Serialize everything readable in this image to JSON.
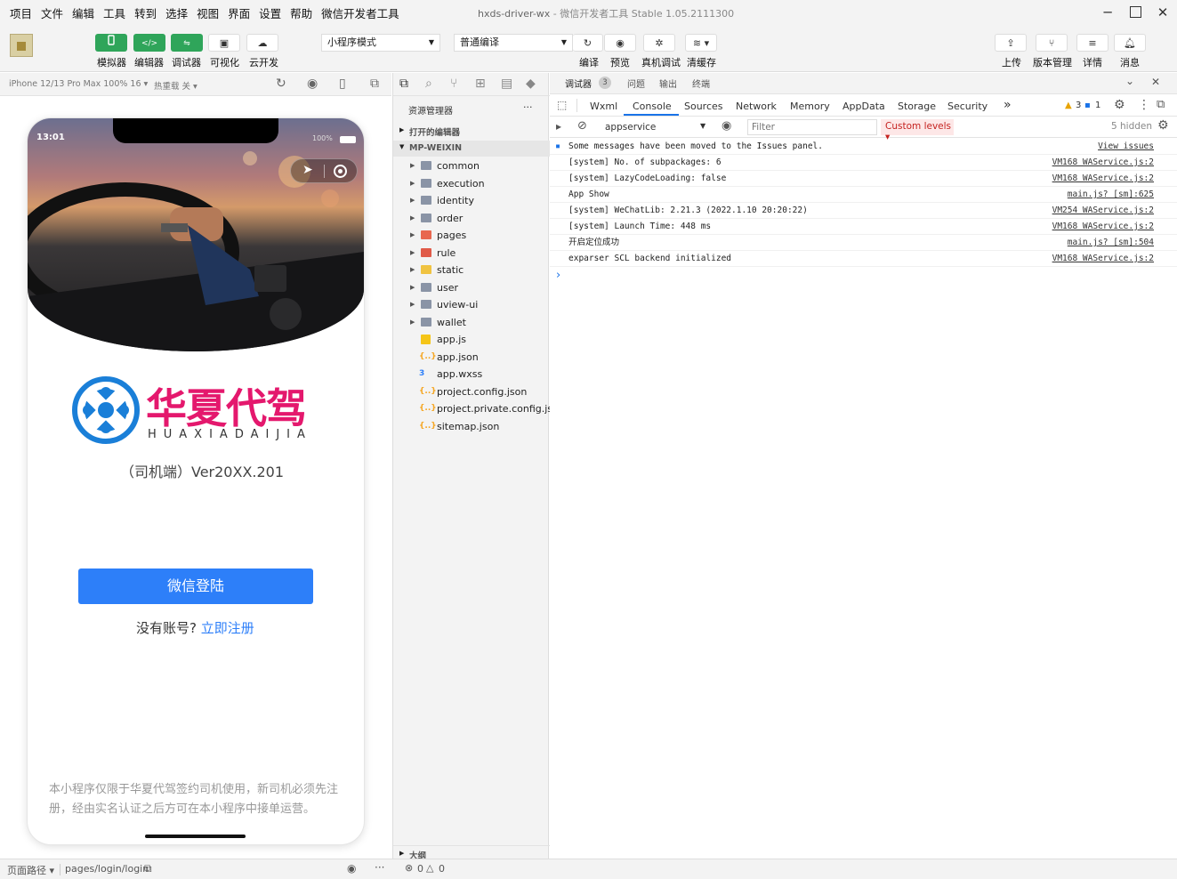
{
  "menu": [
    "项目",
    "文件",
    "编辑",
    "工具",
    "转到",
    "选择",
    "视图",
    "界面",
    "设置",
    "帮助",
    "微信开发者工具"
  ],
  "window": {
    "title": "hxds-driver-wx",
    "subtitle": "- 微信开发者工具 Stable 1.05.2111300"
  },
  "toolbar": {
    "simulator": "模拟器",
    "editor": "编辑器",
    "debugger": "调试器",
    "visual": "可视化",
    "cloud": "云开发",
    "mode": "小程序模式",
    "compile_mode": "普通编译",
    "compile": "编译",
    "preview": "预览",
    "real_debug": "真机调试",
    "clear_cache": "清缓存",
    "upload": "上传",
    "version": "版本管理",
    "details": "详情",
    "messages": "消息"
  },
  "simbar": {
    "device": "iPhone 12/13 Pro Max 100% 16 ▾",
    "hot_reload": "热重载 关 ▾"
  },
  "phone": {
    "time": "13:01",
    "battery": "100%",
    "brand_cn": "华夏代驾",
    "brand_en": "HUAXIADAIJIA",
    "version": "（司机端）Ver20XX.201",
    "login_button": "微信登陆",
    "no_account": "没有账号?",
    "register": "立即注册",
    "notice": "本小程序仅限于华夏代驾签约司机使用，新司机必须先注册，经由实名认证之后方可在本小程序中接单运营。"
  },
  "explorer": {
    "title": "资源管理器",
    "more": "···",
    "open_editors": "打开的编辑器",
    "project": "MP-WEIXIN",
    "folders": [
      {
        "name": "common",
        "color": "#8a94a6"
      },
      {
        "name": "execution",
        "color": "#8a94a6"
      },
      {
        "name": "identity",
        "color": "#8a94a6"
      },
      {
        "name": "order",
        "color": "#8a94a6"
      },
      {
        "name": "pages",
        "color": "#e8674f"
      },
      {
        "name": "rule",
        "color": "#e05a48"
      },
      {
        "name": "static",
        "color": "#f0c341"
      },
      {
        "name": "user",
        "color": "#8a94a6"
      },
      {
        "name": "uview-ui",
        "color": "#8a94a6"
      },
      {
        "name": "wallet",
        "color": "#8a94a6"
      }
    ],
    "files": [
      {
        "name": "app.js",
        "icon": "js-icon",
        "color": "#f5c518",
        "glyph": "JS"
      },
      {
        "name": "app.json",
        "icon": "json-icon",
        "color": "#f5a623",
        "glyph": "{..}"
      },
      {
        "name": "app.wxss",
        "icon": "css-icon",
        "color": "#2d7ff9",
        "glyph": "3"
      },
      {
        "name": "project.config.json",
        "icon": "json-icon",
        "color": "#f5a623",
        "glyph": "{..}"
      },
      {
        "name": "project.private.config.js...",
        "icon": "json-icon",
        "color": "#f5a623",
        "glyph": "{..}"
      },
      {
        "name": "sitemap.json",
        "icon": "json-icon",
        "color": "#f5a623",
        "glyph": "{..}"
      }
    ],
    "outline": "大纲"
  },
  "devtools": {
    "tabs": [
      "调试器",
      "问题",
      "输出",
      "终端"
    ],
    "badge": "3",
    "console_tabs": [
      "Wxml",
      "Console",
      "Sources",
      "Network",
      "Memory",
      "AppData",
      "Storage",
      "Security"
    ],
    "more_tabs": "»",
    "warn_count": "3",
    "info_count": "1",
    "context": "appservice",
    "filter_placeholder": "Filter",
    "levels": "Custom levels ▾",
    "hidden": "5 hidden",
    "logs": [
      {
        "msg": "Some messages have been moved to the Issues panel.",
        "src": "View issues",
        "info": true
      },
      {
        "msg": "[system] No. of subpackages: 6",
        "src": "VM168 WAService.js:2"
      },
      {
        "msg": "[system] LazyCodeLoading: false",
        "src": "VM168 WAService.js:2"
      },
      {
        "msg": "App Show",
        "src": "main.js? [sm]:625"
      },
      {
        "msg": "[system] WeChatLib: 2.21.3 (2022.1.10 20:20:22)",
        "src": "VM254 WAService.js:2"
      },
      {
        "msg": "[system] Launch Time: 448 ms",
        "src": "VM168 WAService.js:2"
      },
      {
        "msg": "开启定位成功",
        "src": "main.js? [sm]:504"
      },
      {
        "msg": "exparser SCL backend initialized",
        "src": "VM168 WAService.js:2"
      }
    ],
    "prompt": "›"
  },
  "status": {
    "path_label": "页面路径 ▾",
    "path": "pages/login/login",
    "errors": "0",
    "warnings": "0"
  },
  "colors": {
    "accent_green": "#2fa55a",
    "brand_pink": "#e4186d",
    "login_blue": "#2d7ff9"
  }
}
